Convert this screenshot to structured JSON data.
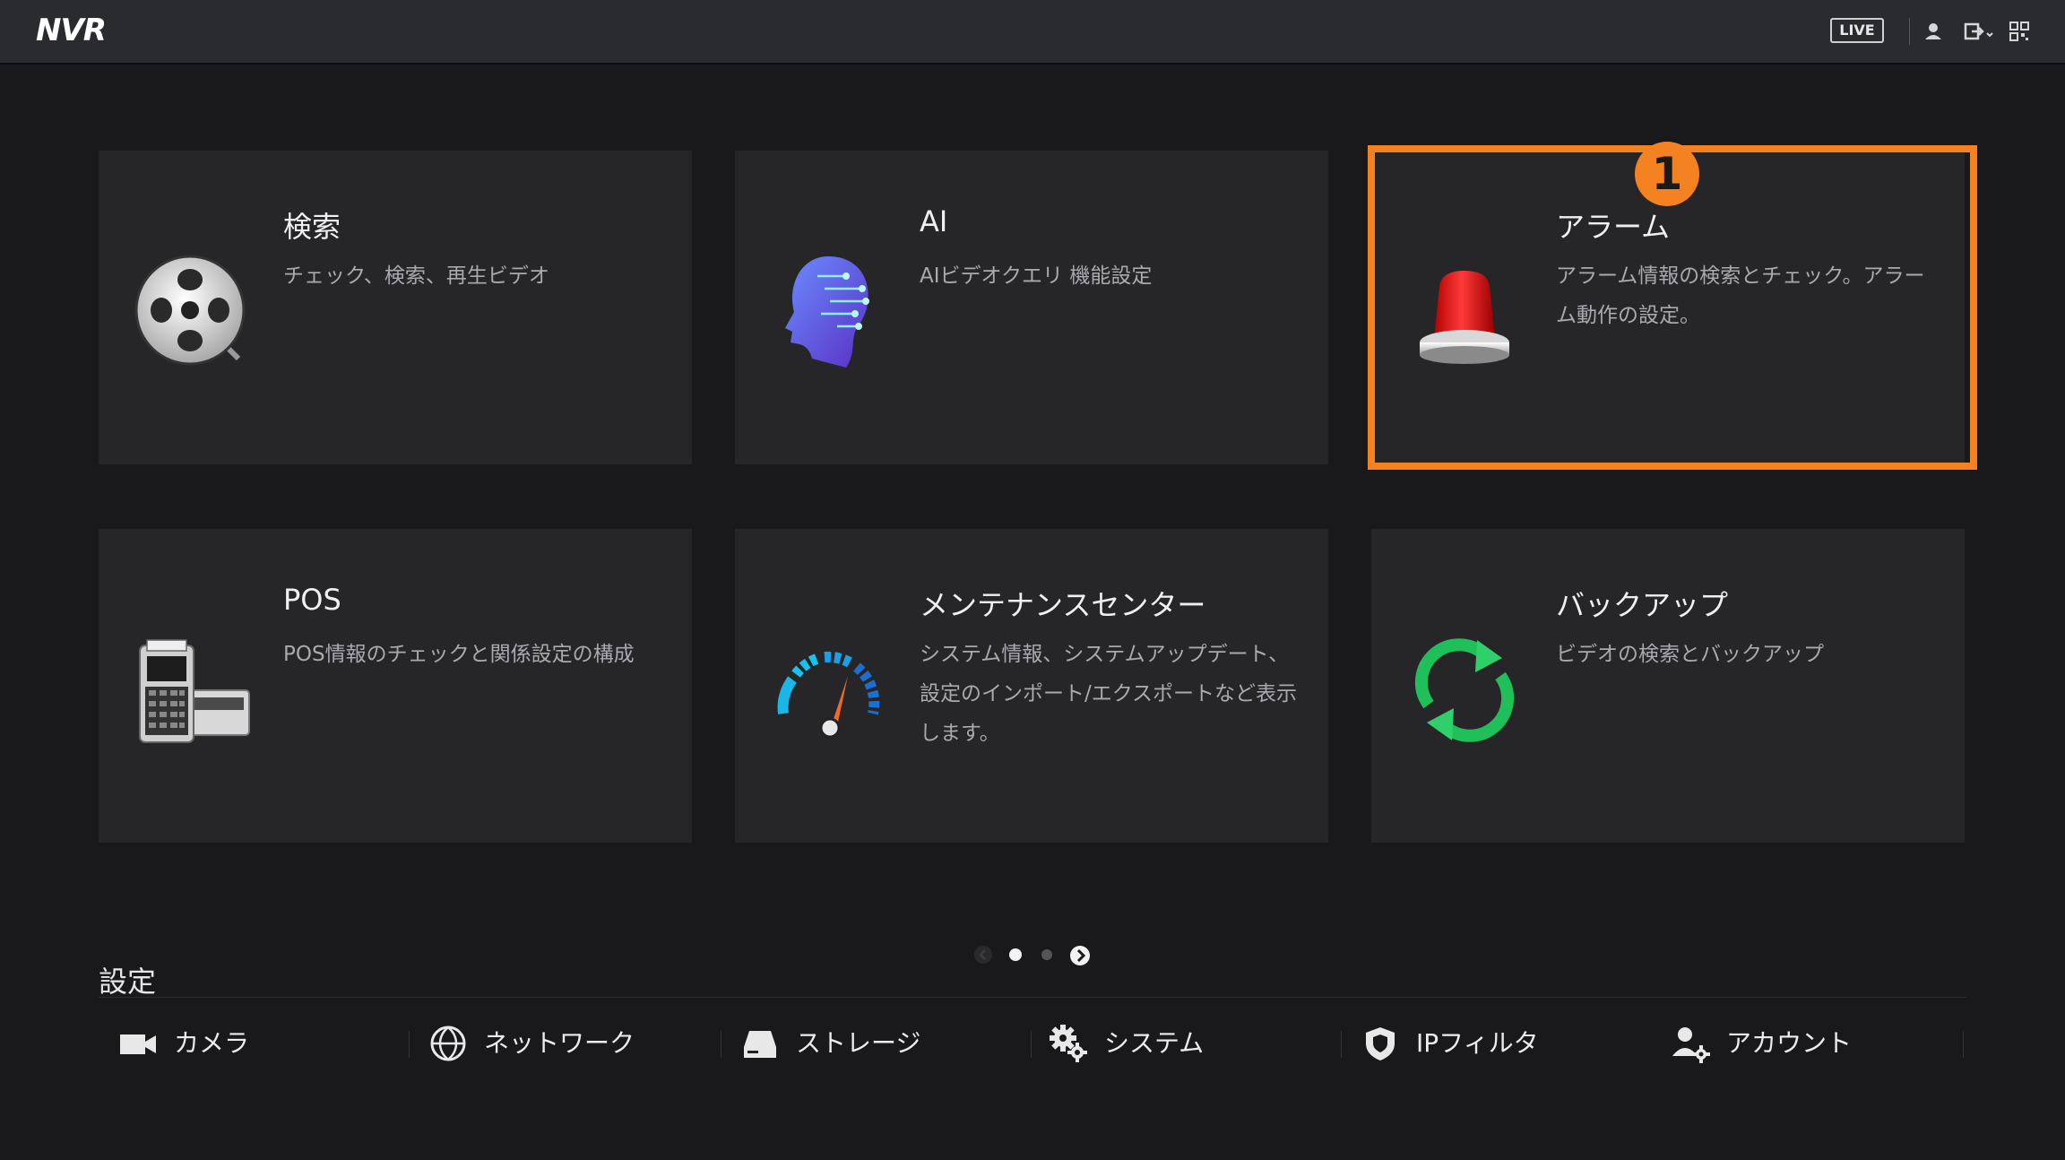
{
  "topbar": {
    "logo": "NVR",
    "live_label": "LIVE"
  },
  "cards": [
    {
      "title": "検索",
      "desc": "チェック、検索、再生ビデオ",
      "icon": "film-reel-icon"
    },
    {
      "title": "AI",
      "desc": "AIビデオクエリ 機能設定",
      "icon": "ai-head-icon"
    },
    {
      "title": "アラーム",
      "desc": "アラーム情報の検索とチェック。アラーム動作の設定。",
      "icon": "alarm-siren-icon"
    },
    {
      "title": "POS",
      "desc": "POS情報のチェックと関係設定の構成",
      "icon": "cash-register-icon"
    },
    {
      "title": "メンテナンスセンター",
      "desc": "システム情報、システムアップデート、設定のインポート/エクスポートなど表示します。",
      "icon": "gauge-icon"
    },
    {
      "title": "バックアップ",
      "desc": "ビデオの検索とバックアップ",
      "icon": "sync-arrows-icon"
    }
  ],
  "annotation": {
    "step": "1",
    "color": "#f58220"
  },
  "pager": {
    "current": 1,
    "total": 2
  },
  "settings": {
    "title": "設定",
    "items": [
      {
        "label": "カメラ",
        "icon": "camera-icon"
      },
      {
        "label": "ネットワーク",
        "icon": "network-globe-icon"
      },
      {
        "label": "ストレージ",
        "icon": "storage-drive-icon"
      },
      {
        "label": "システム",
        "icon": "gears-icon"
      },
      {
        "label": "IPフィルタ",
        "icon": "shield-icon"
      },
      {
        "label": "アカウント",
        "icon": "account-gear-icon"
      }
    ]
  }
}
